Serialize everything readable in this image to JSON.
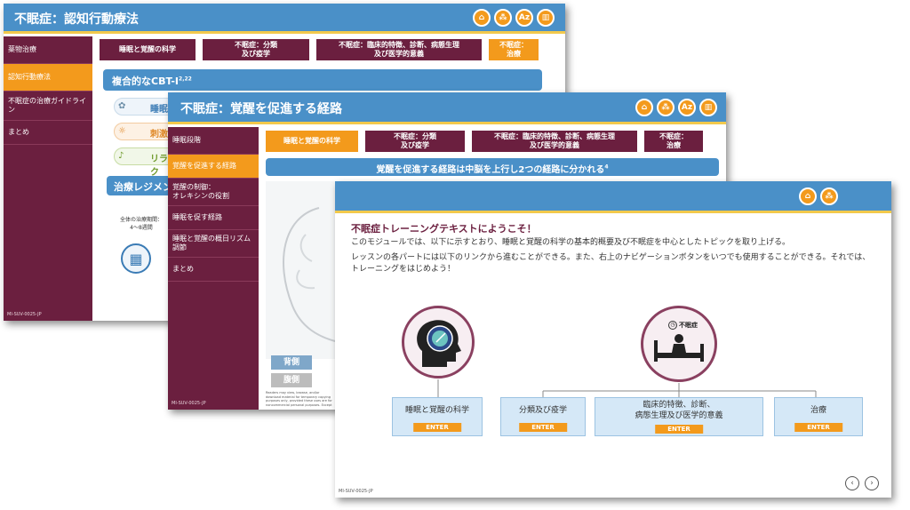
{
  "win1": {
    "title": "不眠症：認知行動療法",
    "icons": [
      "home-icon",
      "network-icon",
      "glossary-icon",
      "reference-icon"
    ],
    "icon_az": "Az",
    "sidebar": [
      "薬物治療",
      "認知行動療法",
      "不眠症の治療ガイドライン",
      "まとめ"
    ],
    "active_sidebar": 1,
    "tabs": [
      "睡眠と覚醒の科学",
      "不眠症：分類\n及び疫学",
      "不眠症：臨床的特徴、診断、病態生理\n及び医学的意義",
      "不眠症：\n治療"
    ],
    "active_tab": 3,
    "banner": "複合的なCBT-I",
    "banner_sup": "2,22",
    "items": [
      "睡眠",
      "刺激",
      "リラク"
    ],
    "section2": "治療レジメン",
    "regimen_label": "全体の治療期間：\n4～8週間",
    "code": "MI-SUV-0025-JP"
  },
  "win2": {
    "title": "不眠症：覚醒を促進する経路",
    "icon_az": "Az",
    "sidebar": [
      "睡眠段階",
      "覚醒を促進する経路",
      "覚醒の制御：\nオレキシンの役割",
      "睡眠を促す経路",
      "睡眠と覚醒の概日リズム調節",
      "まとめ"
    ],
    "active_sidebar": 1,
    "tabs": [
      "睡眠と覚醒の科学",
      "不眠症：分類\n及び疫学",
      "不眠症：臨床的特徴、診断、病態生理\n及び医学的意義",
      "不眠症：\n治療"
    ],
    "active_tab": 0,
    "banner": "覚醒を促進する経路は中脳を上行し2つの経路に分かれる",
    "banner_sup": "4",
    "btn_back": "背側",
    "btn_belly": "腹側",
    "footer_note": "Readers may view, browse, and/or download material for temporary copying purposes only, provided these uses are for noncommercial personal purposes. Except as provided by law, this material may not be further reproduced, distributed, transmitted, modified, adapted, performed, displayed, published, or sold in whole or in part, without prior written permission from the publisher.",
    "code": "MI-SUV-0025-JP"
  },
  "win3": {
    "heading": "不眠症トレーニングテキストにようこそ！",
    "para1": "このモジュールでは、以下に示すとおり、睡眠と覚醒の科学の基本的概要及び不眠症を中心としたトピックを取り上げる。",
    "para2": "レッスンの各パートには以下のリンクから進むことができる。また、右上のナビゲーションボタンをいつでも使用することができる。それでは、トレーニングをはじめよう！",
    "illus_label": "不眠症",
    "boxes": [
      "睡眠と覚醒の科学",
      "分類及び疫学",
      "臨床的特徴、診断、\n病態生理及び医学的意義",
      "治療"
    ],
    "enter": "ENTER",
    "code": "MI-SUV-0025-JP",
    "prev": "‹",
    "next": "›"
  },
  "colors": {
    "header": "#4a90c8",
    "sidebar": "#6b1f3f",
    "accent": "#f39a1c",
    "rule": "#f2c94c"
  }
}
